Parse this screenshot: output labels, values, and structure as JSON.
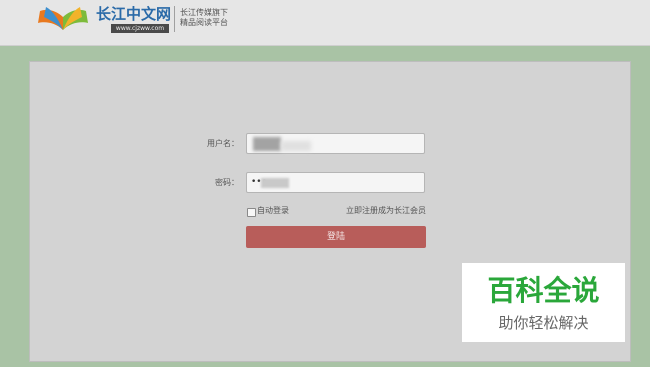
{
  "header": {
    "site_name": "长江中文网",
    "site_url": "www.cjzww.com",
    "tagline_line1": "长江传媒旗下",
    "tagline_line2": "精品阅读平台"
  },
  "login": {
    "username_label": "用户名：",
    "password_label": "密码：",
    "password_mask": "•••",
    "auto_login_label": "自动登录",
    "register_link": "立即注册成为长江会员",
    "login_button": "登陆"
  },
  "watermark": {
    "title": "百科全说",
    "subtitle": "助你轻松解决"
  },
  "colors": {
    "background": "#a9c3a5",
    "panel": "#d3d3d3",
    "button": "#b85d5a",
    "brand_blue": "#2a6aa8",
    "watermark_green": "#2aa73a"
  }
}
